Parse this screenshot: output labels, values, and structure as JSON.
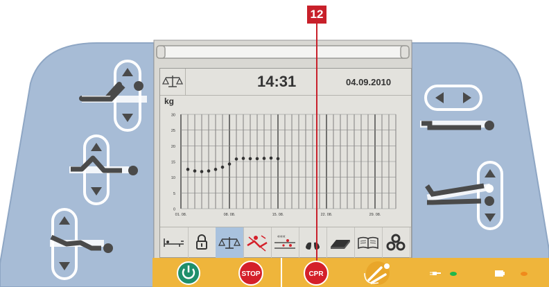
{
  "callout": {
    "number": "12"
  },
  "screen": {
    "time": "14:31",
    "date": "04.09.2010",
    "unit": "kg",
    "y_ticks": [
      "30",
      "25",
      "20",
      "15",
      "10",
      "5",
      "0"
    ],
    "x_ticks": [
      "01. 08.",
      "08. 08.",
      "15. 08.",
      "22. 08.",
      "29. 08."
    ]
  },
  "chart_data": {
    "type": "scatter",
    "ylabel": "kg",
    "ylim": [
      0,
      30
    ],
    "y_ticks": [
      0,
      5,
      10,
      15,
      20,
      25,
      30
    ],
    "x_tick_labels": [
      "01. 08.",
      "08. 08.",
      "15. 08.",
      "22. 08.",
      "29. 08."
    ],
    "series": [
      {
        "values": [
          12.5,
          12,
          11.8,
          12,
          12.5,
          13.2,
          14.2,
          15.8,
          16,
          15.9,
          15.9,
          16,
          16.1,
          15.9
        ]
      }
    ]
  },
  "tabs": [
    {
      "icon": "bed-flat-icon"
    },
    {
      "icon": "lock-icon"
    },
    {
      "icon": "scale-icon",
      "active": true
    },
    {
      "icon": "bed-exit-alarm-icon"
    },
    {
      "icon": "pressure-rotation-icon"
    },
    {
      "icon": "lungs-icon"
    },
    {
      "icon": "mattress-icon"
    },
    {
      "icon": "manual-book-icon"
    },
    {
      "icon": "settings-gears-icon"
    }
  ],
  "bottom": {
    "stop_label": "STOP",
    "cpr_label": "CPR",
    "colors": {
      "bar": "#efb53b",
      "panel": "#a7bcd6",
      "green": "#1f8f6b",
      "red": "#d4202a",
      "led_green": "#1fb84b",
      "led_orange": "#f08a1c"
    }
  },
  "icons": {
    "power": "power-icon",
    "stop": "stop-button",
    "cpr": "cpr-button",
    "chair": "chair-position-icon",
    "plug": "mains-plug-icon",
    "battery": "battery-icon"
  }
}
